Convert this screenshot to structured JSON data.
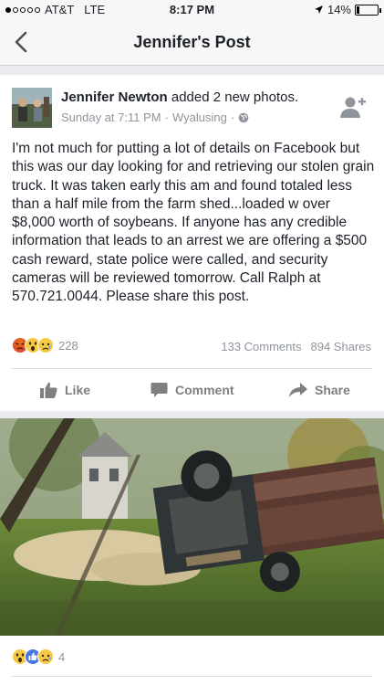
{
  "status_bar": {
    "carrier": "AT&T",
    "network": "LTE",
    "time": "8:17 PM",
    "battery_percent": "14%",
    "battery_level": 0.14
  },
  "nav": {
    "title": "Jennifer's Post",
    "back_icon": "chevron-left-icon"
  },
  "post": {
    "author": "Jennifer Newton",
    "action": " added 2 new photos.",
    "timestamp": "Sunday at 7:11 PM",
    "location": "Wyalusing",
    "privacy_icon": "globe-icon",
    "text": "I'm not much for putting a lot of details on Facebook but this was our day looking for and retrieving our stolen grain truck.  It was taken early this am and found totaled less than a half mile from the farm shed...loaded w over $8,000 worth of soybeans.  If anyone has any credible information that leads to an arrest  we are offering a $500 cash reward, state police were called, and security cameras will be reviewed tomorrow. Call Ralph at 570.721.0044.  Please share this post.",
    "reaction_count": "228",
    "comments": "133 Comments",
    "shares": "894 Shares"
  },
  "actions": {
    "like": "Like",
    "comment": "Comment",
    "share": "Share"
  },
  "photo": {
    "reaction_count": "4"
  },
  "colors": {
    "facebook_blue": "#4267b2",
    "meta_gray": "#90949c",
    "action_gray": "#7f7f7f"
  }
}
